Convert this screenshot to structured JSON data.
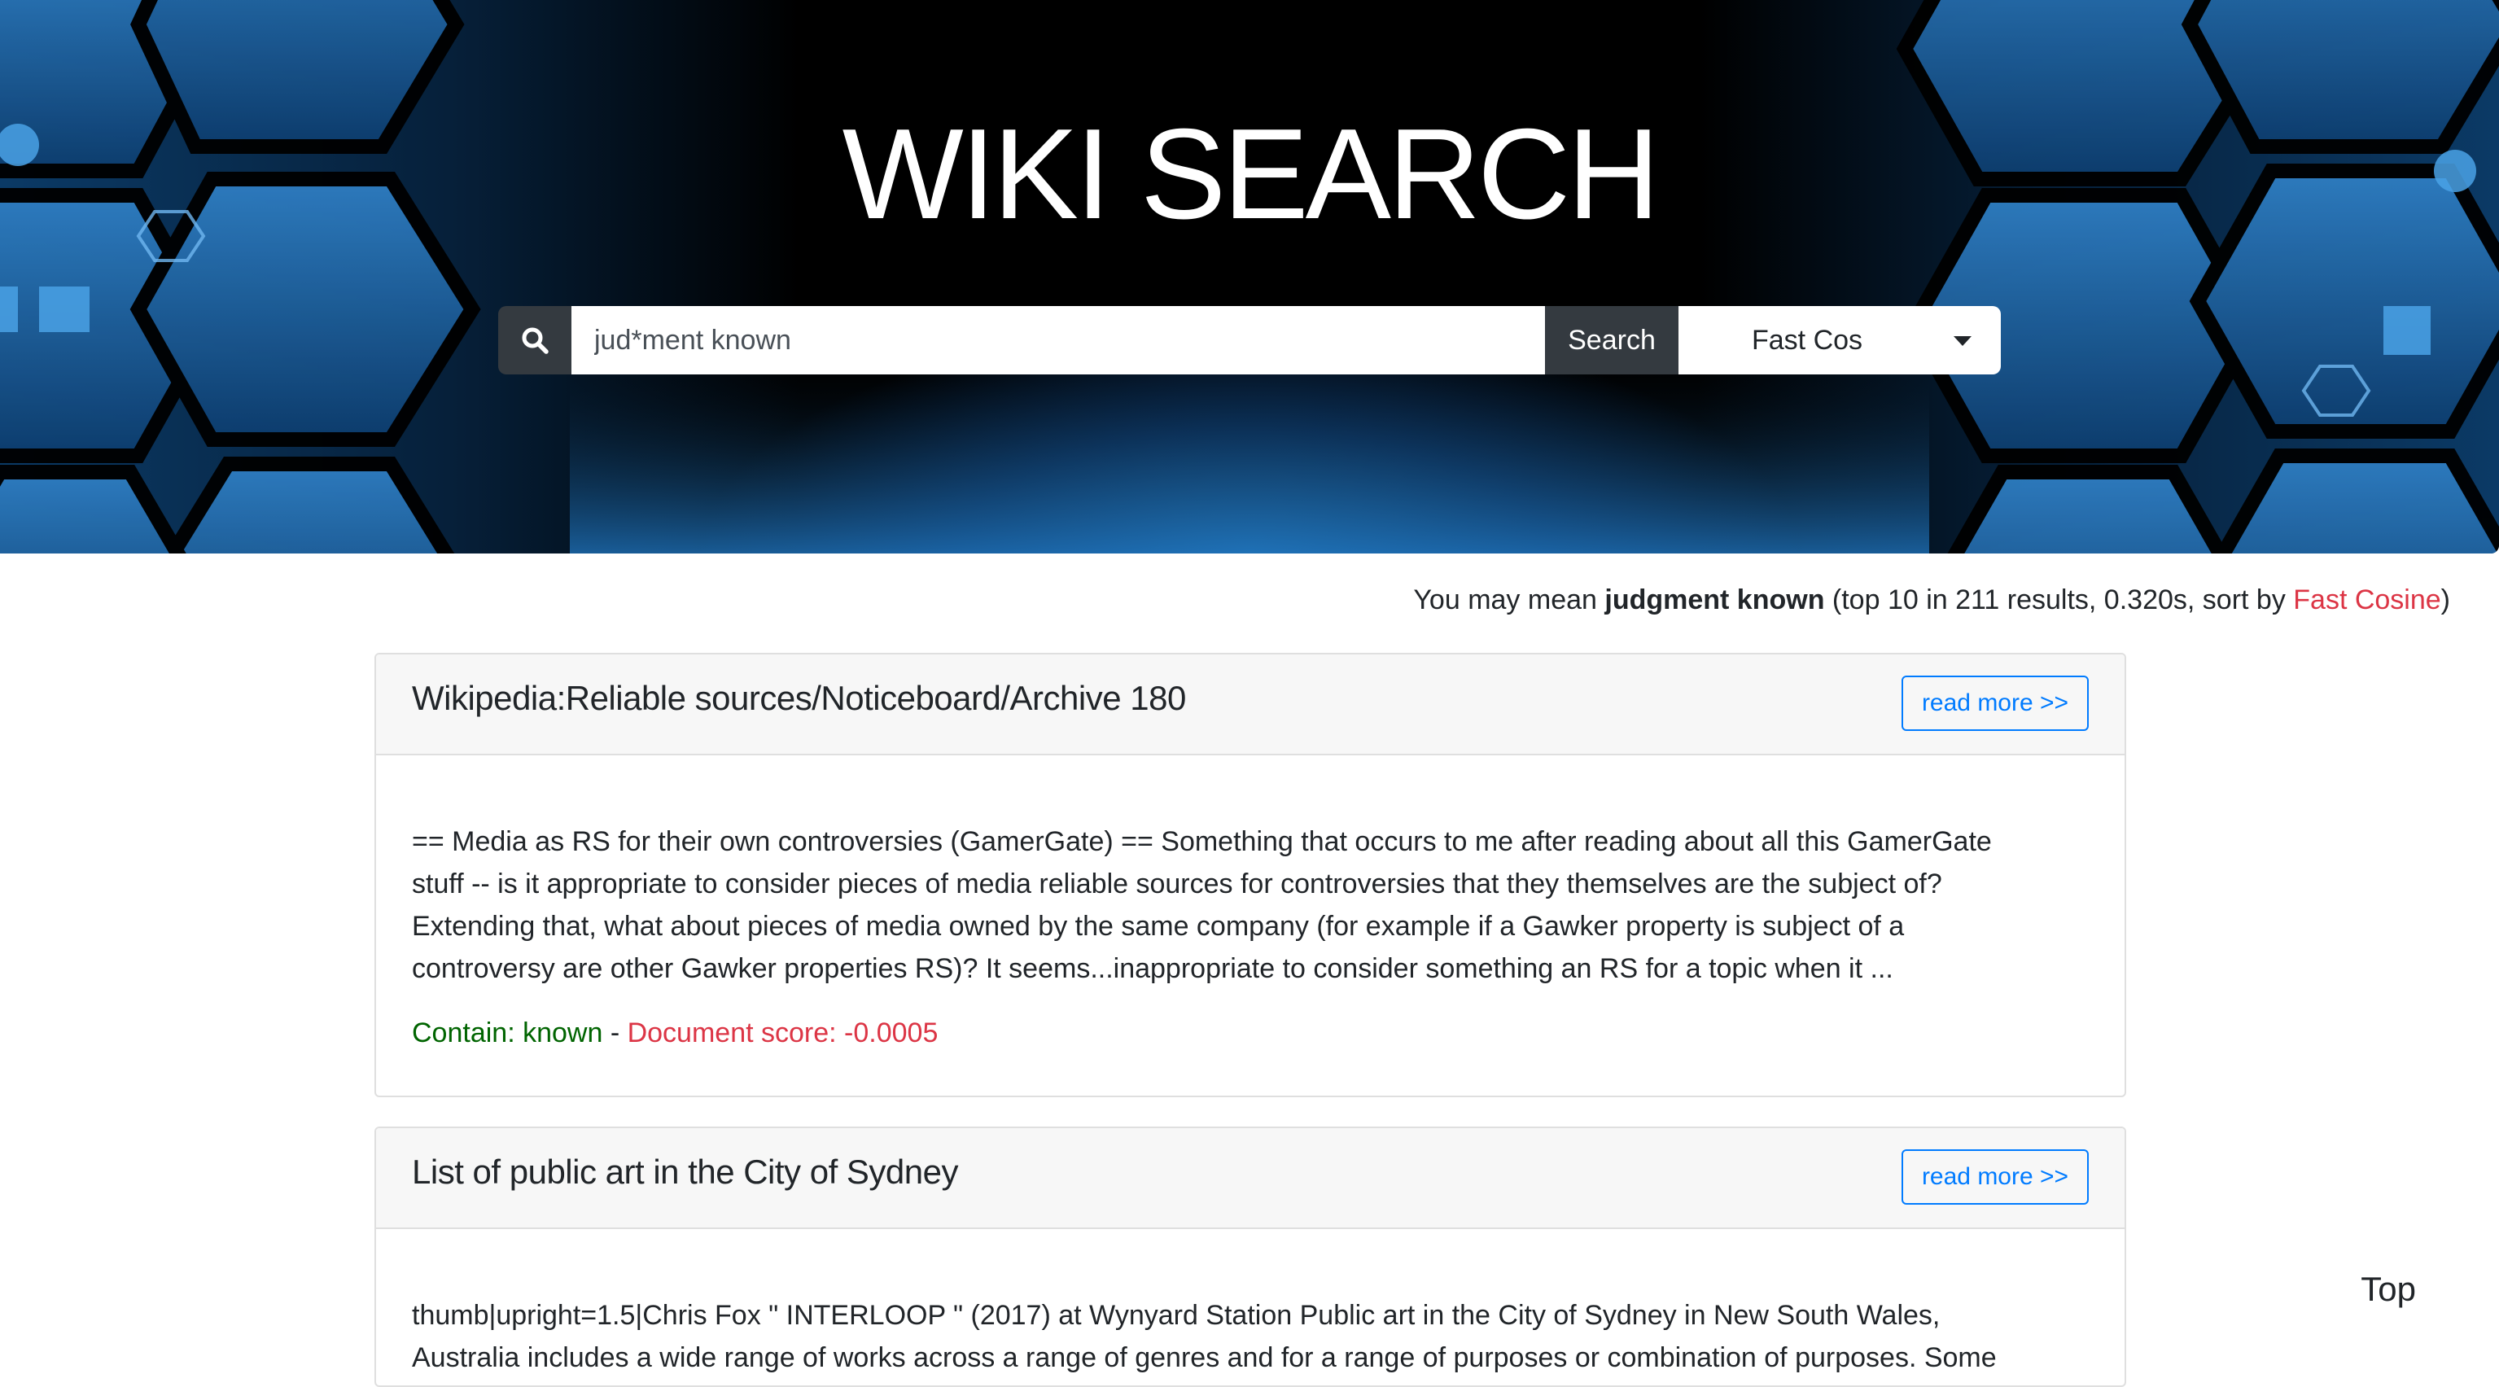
{
  "hero": {
    "title": "WIKI SEARCH"
  },
  "search": {
    "query": "jud*ment known",
    "button_label": "Search",
    "sort_selected": "Fast Cos",
    "icon": "search-icon"
  },
  "result_info": {
    "prefix": "You may mean ",
    "suggestion": "judgment known",
    "middle": " (top 10 in 211 results, 0.320s, sort by ",
    "sort_name": "Fast Cosine",
    "suffix": ")"
  },
  "results": [
    {
      "title": "Wikipedia:Reliable sources/Noticeboard/Archive 180",
      "read_more": "read more >>",
      "lines": [
        "== Media as RS for their own controversies (GamerGate) == Something that occurs to me after reading about all this GamerGate",
        "stuff -- is it appropriate to consider pieces of media reliable sources for controversies that they themselves are the subject of?",
        "Extending that, what about pieces of media owned by the same company (for example if a Gawker property is subject of a",
        "controversy are other Gawker properties RS)? It seems...inappropriate to consider something an RS for a topic when it ..."
      ],
      "contain": "Contain: known",
      "separator": " - ",
      "score": "Document score: -0.0005"
    },
    {
      "title": "List of public art in the City of Sydney",
      "read_more": "read more >>",
      "lines": [
        "thumb|upright=1.5|Chris Fox \" INTERLOOP \" (2017) at Wynyard Station Public art in the City of Sydney in New South Wales,",
        "Australia includes a wide range of works across a range of genres and for a range of purposes or combination of purposes. Some"
      ]
    }
  ],
  "top_link": "Top",
  "colors": {
    "accent_blue": "#007bff",
    "score_red": "#dc3545",
    "contain_green": "#006400",
    "dark": "#343a40"
  }
}
